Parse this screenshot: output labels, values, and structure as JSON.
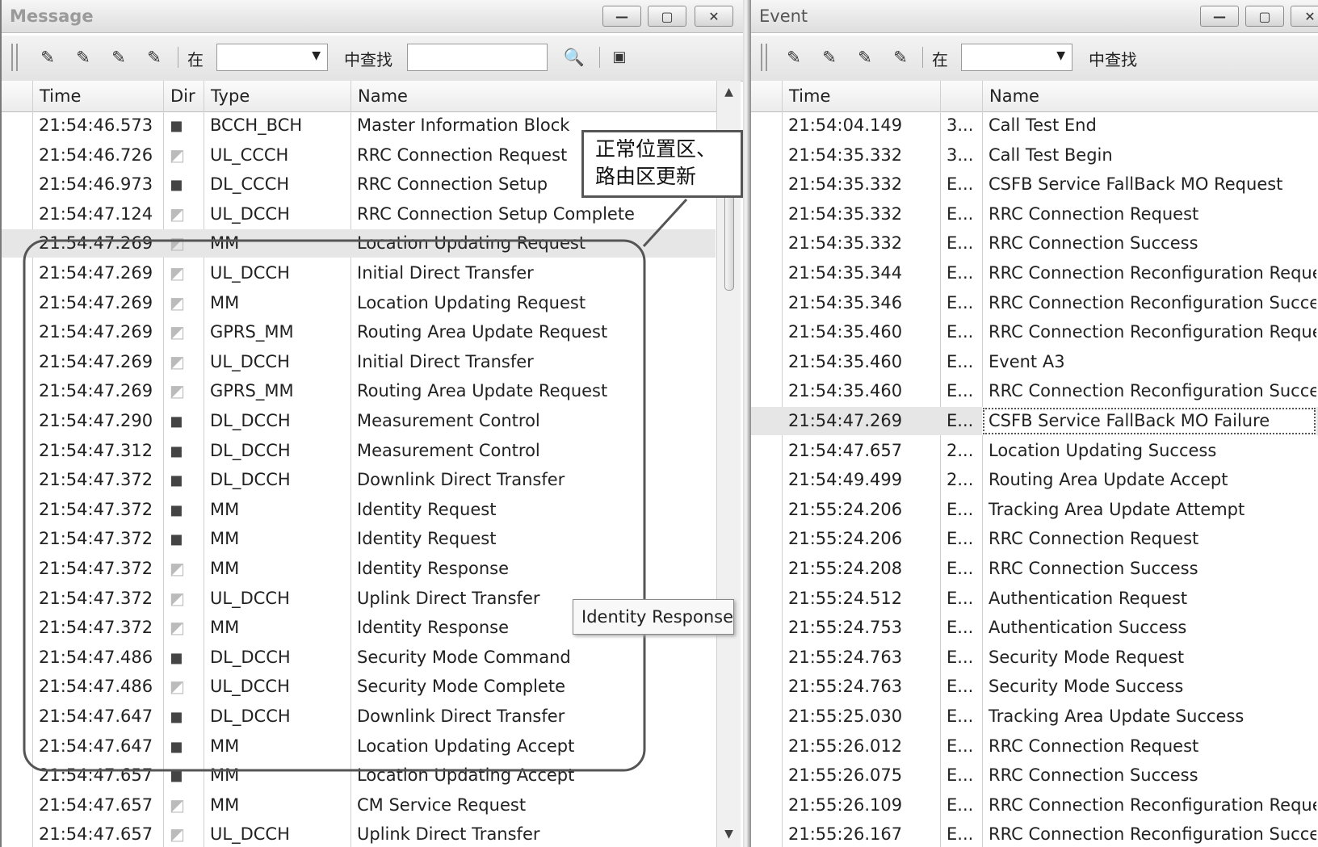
{
  "message_panel": {
    "title": "Message",
    "window_buttons": [
      "—",
      "▢",
      "✕"
    ],
    "toolbar": {
      "in_label": "在",
      "find_label": "中查找",
      "search_value": "",
      "scope_value": ""
    },
    "columns": [
      "Time",
      "Dir",
      "Type",
      "Name"
    ],
    "rows": [
      {
        "time": "21:54:46.573",
        "dir": "down",
        "type": "BCCH_BCH",
        "name": "Master Information Block"
      },
      {
        "time": "21:54:46.726",
        "dir": "up",
        "type": "UL_CCCH",
        "name": "RRC Connection Request"
      },
      {
        "time": "21:54:46.973",
        "dir": "down",
        "type": "DL_CCCH",
        "name": "RRC Connection Setup"
      },
      {
        "time": "21:54:47.124",
        "dir": "up",
        "type": "UL_DCCH",
        "name": "RRC Connection Setup Complete"
      },
      {
        "time": "21:54:47.269",
        "dir": "up",
        "type": "MM",
        "name": "Location Updating Request"
      },
      {
        "time": "21:54:47.269",
        "dir": "up",
        "type": "UL_DCCH",
        "name": "Initial Direct Transfer"
      },
      {
        "time": "21:54:47.269",
        "dir": "up",
        "type": "MM",
        "name": "Location Updating Request"
      },
      {
        "time": "21:54:47.269",
        "dir": "up",
        "type": "GPRS_MM",
        "name": "Routing Area Update Request"
      },
      {
        "time": "21:54:47.269",
        "dir": "up",
        "type": "UL_DCCH",
        "name": "Initial Direct Transfer"
      },
      {
        "time": "21:54:47.269",
        "dir": "up",
        "type": "GPRS_MM",
        "name": "Routing Area Update Request"
      },
      {
        "time": "21:54:47.290",
        "dir": "down",
        "type": "DL_DCCH",
        "name": "Measurement Control"
      },
      {
        "time": "21:54:47.312",
        "dir": "down",
        "type": "DL_DCCH",
        "name": "Measurement Control"
      },
      {
        "time": "21:54:47.372",
        "dir": "down",
        "type": "DL_DCCH",
        "name": "Downlink Direct Transfer"
      },
      {
        "time": "21:54:47.372",
        "dir": "down",
        "type": "MM",
        "name": "Identity Request"
      },
      {
        "time": "21:54:47.372",
        "dir": "down",
        "type": "MM",
        "name": "Identity Request"
      },
      {
        "time": "21:54:47.372",
        "dir": "up",
        "type": "MM",
        "name": "Identity Response"
      },
      {
        "time": "21:54:47.372",
        "dir": "up",
        "type": "UL_DCCH",
        "name": "Uplink Direct Transfer"
      },
      {
        "time": "21:54:47.372",
        "dir": "up",
        "type": "MM",
        "name": "Identity Response"
      },
      {
        "time": "21:54:47.486",
        "dir": "down",
        "type": "DL_DCCH",
        "name": "Security Mode Command"
      },
      {
        "time": "21:54:47.486",
        "dir": "up",
        "type": "UL_DCCH",
        "name": "Security Mode Complete"
      },
      {
        "time": "21:54:47.647",
        "dir": "down",
        "type": "DL_DCCH",
        "name": "Downlink Direct Transfer"
      },
      {
        "time": "21:54:47.647",
        "dir": "down",
        "type": "MM",
        "name": "Location Updating Accept"
      },
      {
        "time": "21:54:47.657",
        "dir": "down",
        "type": "MM",
        "name": "Location Updating Accept"
      },
      {
        "time": "21:54:47.657",
        "dir": "up",
        "type": "MM",
        "name": "CM Service Request"
      },
      {
        "time": "21:54:47.657",
        "dir": "up",
        "type": "UL_DCCH",
        "name": "Uplink Direct Transfer"
      }
    ],
    "annotation": {
      "line1": "正常位置区、",
      "line2": "路由区更新"
    },
    "tooltip": "Identity Response"
  },
  "event_panel": {
    "title": "Event",
    "window_buttons": [
      "—",
      "▢",
      "✕"
    ],
    "toolbar": {
      "in_label": "在",
      "find_label": "中查找",
      "scope_value": ""
    },
    "columns": [
      "Time",
      "",
      "Name"
    ],
    "rows": [
      {
        "time": "21:54:04.149",
        "code": "3...",
        "name": "Call Test End"
      },
      {
        "time": "21:54:35.332",
        "code": "3...",
        "name": "Call Test Begin"
      },
      {
        "time": "21:54:35.332",
        "code": "E...",
        "name": "CSFB Service FallBack MO Request"
      },
      {
        "time": "21:54:35.332",
        "code": "E...",
        "name": "RRC Connection Request"
      },
      {
        "time": "21:54:35.332",
        "code": "E...",
        "name": "RRC Connection Success"
      },
      {
        "time": "21:54:35.344",
        "code": "E...",
        "name": "RRC Connection Reconfiguration Request"
      },
      {
        "time": "21:54:35.346",
        "code": "E...",
        "name": "RRC Connection Reconfiguration Success"
      },
      {
        "time": "21:54:35.460",
        "code": "E...",
        "name": "RRC Connection Reconfiguration Request"
      },
      {
        "time": "21:54:35.460",
        "code": "E...",
        "name": "Event A3"
      },
      {
        "time": "21:54:35.460",
        "code": "E...",
        "name": "RRC Connection Reconfiguration Success"
      },
      {
        "time": "21:54:47.269",
        "code": "E...",
        "name": "CSFB Service FallBack MO Failure"
      },
      {
        "time": "21:54:47.657",
        "code": "2...",
        "name": "Location Updating Success"
      },
      {
        "time": "21:54:49.499",
        "code": "2...",
        "name": "Routing Area Update Accept"
      },
      {
        "time": "21:55:24.206",
        "code": "E...",
        "name": "Tracking Area Update Attempt"
      },
      {
        "time": "21:55:24.206",
        "code": "E...",
        "name": "RRC Connection Request"
      },
      {
        "time": "21:55:24.208",
        "code": "E...",
        "name": "RRC Connection Success"
      },
      {
        "time": "21:55:24.512",
        "code": "E...",
        "name": "Authentication Request"
      },
      {
        "time": "21:55:24.753",
        "code": "E...",
        "name": "Authentication Success"
      },
      {
        "time": "21:55:24.763",
        "code": "E...",
        "name": "Security Mode Request"
      },
      {
        "time": "21:55:24.763",
        "code": "E...",
        "name": "Security Mode Success"
      },
      {
        "time": "21:55:25.030",
        "code": "E...",
        "name": "Tracking Area Update Success"
      },
      {
        "time": "21:55:26.012",
        "code": "E...",
        "name": "RRC Connection Request"
      },
      {
        "time": "21:55:26.075",
        "code": "E...",
        "name": "RRC Connection Success"
      },
      {
        "time": "21:55:26.109",
        "code": "E...",
        "name": "RRC Connection Reconfiguration Request"
      },
      {
        "time": "21:55:26.167",
        "code": "E...",
        "name": "RRC Connection Reconfiguration Success"
      }
    ]
  }
}
